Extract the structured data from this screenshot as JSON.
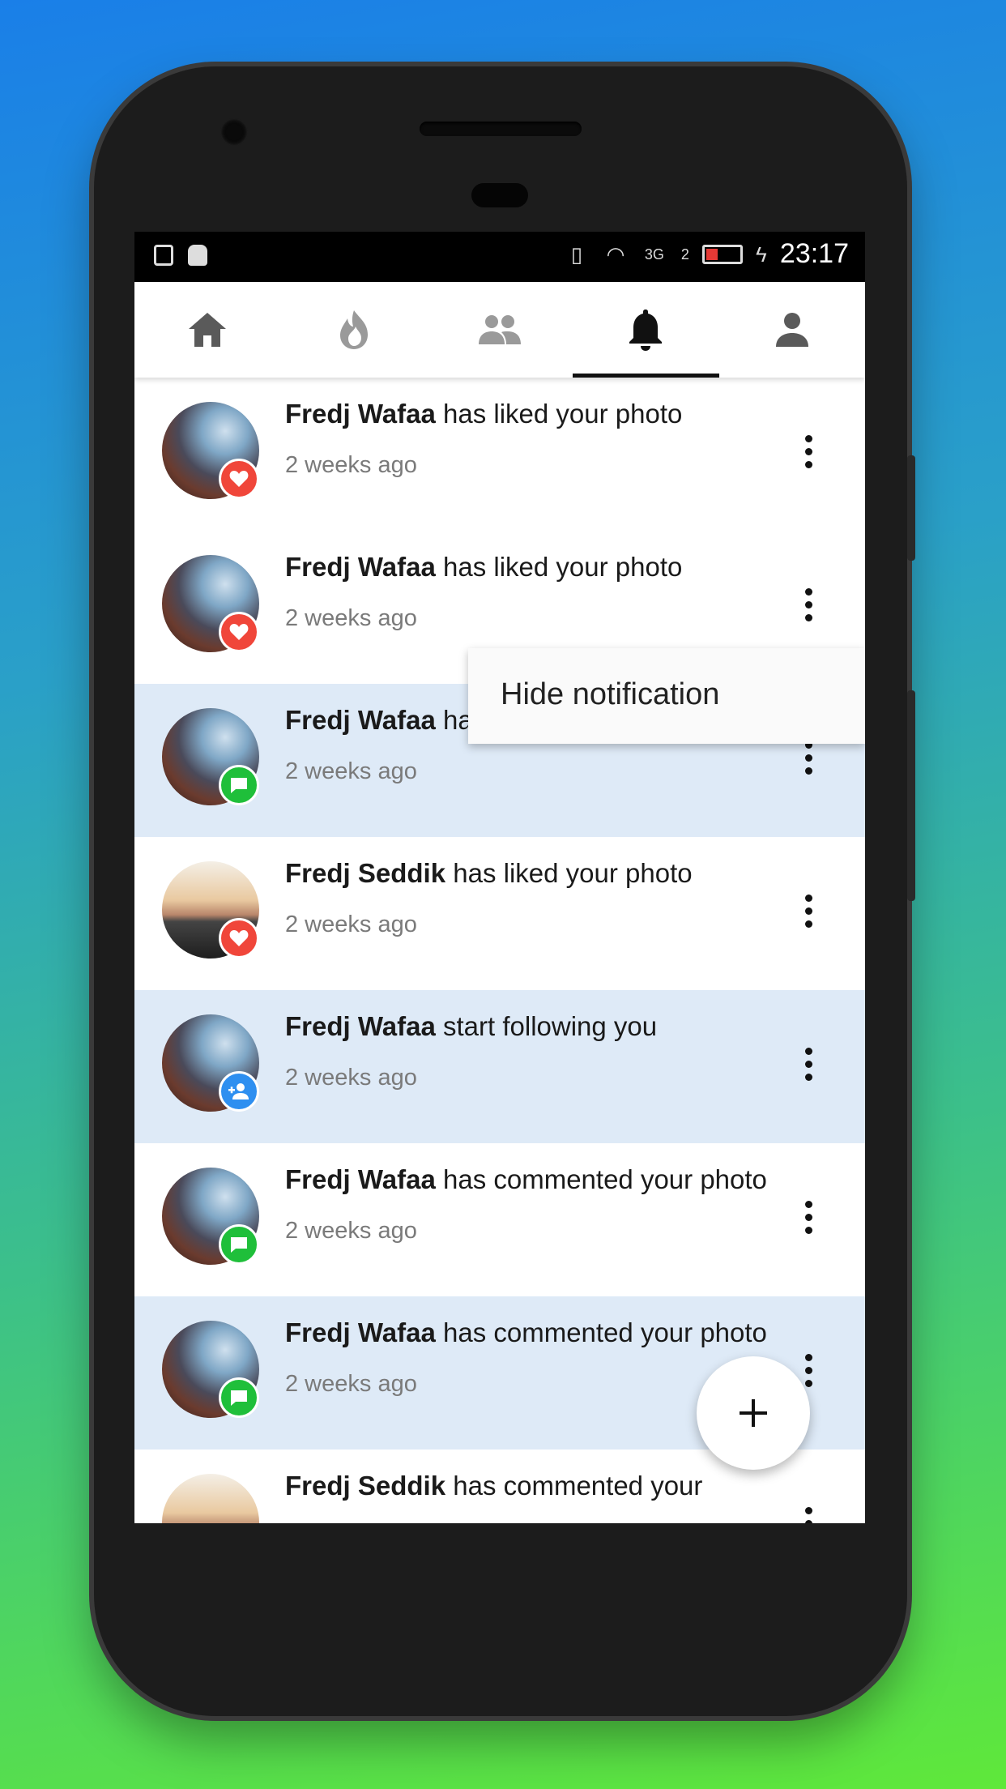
{
  "status_bar": {
    "time": "23:17",
    "network": "3G",
    "sim": "2"
  },
  "tabs": [
    {
      "name": "home",
      "icon": "home-icon",
      "active": false
    },
    {
      "name": "trending",
      "icon": "flame-icon",
      "active": false
    },
    {
      "name": "friends",
      "icon": "people-icon",
      "active": false
    },
    {
      "name": "notifications",
      "icon": "bell-icon",
      "active": true
    },
    {
      "name": "profile",
      "icon": "person-icon",
      "active": false
    }
  ],
  "notifications": [
    {
      "name": "Fredj Wafaa",
      "action": "has liked your photo",
      "time": "2 weeks ago",
      "type": "like",
      "highlight": false
    },
    {
      "name": "Fredj Wafaa",
      "action": "has liked your photo",
      "time": "2 weeks ago",
      "type": "like",
      "highlight": false
    },
    {
      "name": "Fredj Wafaa",
      "action": "ha",
      "time": "2 weeks ago",
      "type": "comment",
      "highlight": true
    },
    {
      "name": "Fredj Seddik",
      "action": "has liked your photo",
      "time": "2 weeks ago",
      "type": "like",
      "highlight": false
    },
    {
      "name": "Fredj Wafaa",
      "action": "start following you",
      "time": "2 weeks ago",
      "type": "follow",
      "highlight": true
    },
    {
      "name": "Fredj Wafaa",
      "action": "has commented your photo",
      "time": "2 weeks ago",
      "type": "comment",
      "highlight": false
    },
    {
      "name": "Fredj Wafaa",
      "action": "has commented your photo",
      "time": "2 weeks ago",
      "type": "comment",
      "highlight": true
    },
    {
      "name": "Fredj Seddik",
      "action": "has commented your",
      "time": "",
      "type": "comment",
      "highlight": false
    }
  ],
  "popup_menu": {
    "item": "Hide notification"
  },
  "fab": {
    "label": "+"
  },
  "colors": {
    "like": "#f0463a",
    "comment": "#1fbf3a",
    "follow": "#2e8ff0",
    "highlight": "#deeaf7"
  }
}
